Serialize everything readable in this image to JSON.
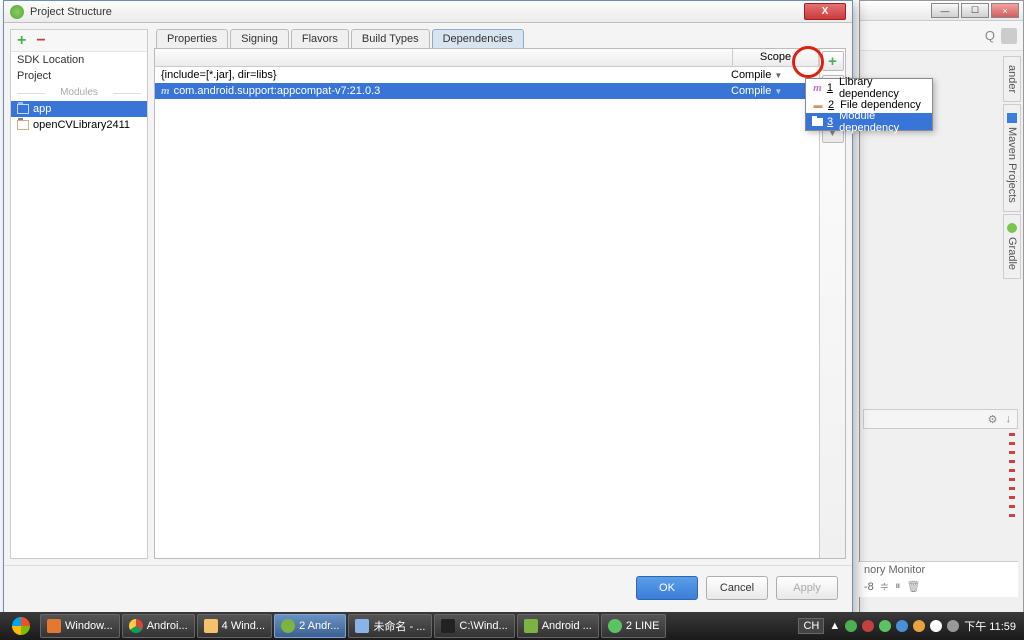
{
  "bg": {
    "win_min": "—",
    "win_max": "☐",
    "win_close": "×",
    "right_tabs": [
      "ander",
      "Maven Projects",
      "Gradle"
    ],
    "tools": {
      "gear": "⚙",
      "arrow": "↓"
    },
    "monitor": {
      "title": "nory Monitor",
      "level": "-8",
      "suffix": "≑"
    }
  },
  "dialog": {
    "title": "Project Structure",
    "close": "X",
    "sidebar": {
      "items": [
        "SDK Location",
        "Project"
      ],
      "sep": "Modules",
      "modules": [
        {
          "name": "app",
          "sel": true
        },
        {
          "name": "openCVLibrary2411",
          "sel": false
        }
      ]
    },
    "tabs": [
      {
        "label": "Properties",
        "active": false
      },
      {
        "label": "Signing",
        "active": false
      },
      {
        "label": "Flavors",
        "active": false
      },
      {
        "label": "Build Types",
        "active": false
      },
      {
        "label": "Dependencies",
        "active": true
      }
    ],
    "dep": {
      "scope_hdr": "Scope",
      "rows": [
        {
          "name": "{include=[*.jar], dir=libs}",
          "scope": "Compile",
          "sel": false,
          "icon": ""
        },
        {
          "name": "com.android.support:appcompat-v7:21.0.3",
          "scope": "Compile",
          "sel": true,
          "icon": "m"
        }
      ]
    },
    "popup": [
      {
        "key": "1",
        "label": "Library dependency",
        "icon": "m",
        "sel": false
      },
      {
        "key": "2",
        "label": "File dependency",
        "icon": "file",
        "sel": false
      },
      {
        "key": "3",
        "label": "Module dependency",
        "icon": "folder",
        "sel": true
      }
    ],
    "footer": {
      "ok": "OK",
      "cancel": "Cancel",
      "apply": "Apply"
    }
  },
  "taskbar": {
    "items": [
      {
        "label": "Window..."
      },
      {
        "label": "Androi..."
      },
      {
        "label": "4 Wind..."
      },
      {
        "label": "2 Andr...",
        "active": true
      },
      {
        "label": "未命名 - ..."
      },
      {
        "label": "C:\\Wind..."
      },
      {
        "label": "Android ..."
      },
      {
        "label": "2 LINE"
      }
    ],
    "tray": {
      "lang": "CH",
      "arrow": "▲",
      "time": "下午 11:59"
    }
  }
}
